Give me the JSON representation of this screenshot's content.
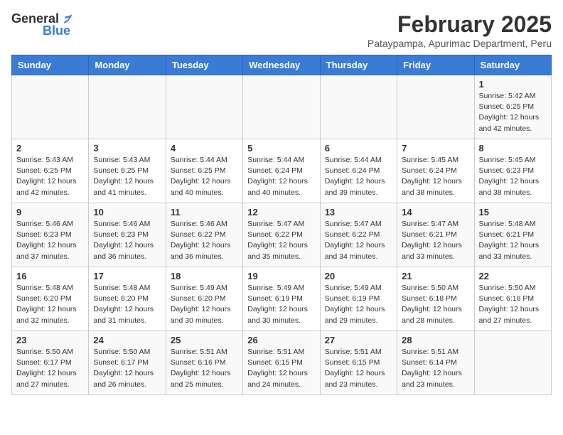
{
  "logo": {
    "text_general": "General",
    "text_blue": "Blue"
  },
  "title": "February 2025",
  "subtitle": "Pataypampa, Apurimac Department, Peru",
  "days_of_week": [
    "Sunday",
    "Monday",
    "Tuesday",
    "Wednesday",
    "Thursday",
    "Friday",
    "Saturday"
  ],
  "weeks": [
    [
      {
        "day": "",
        "info": ""
      },
      {
        "day": "",
        "info": ""
      },
      {
        "day": "",
        "info": ""
      },
      {
        "day": "",
        "info": ""
      },
      {
        "day": "",
        "info": ""
      },
      {
        "day": "",
        "info": ""
      },
      {
        "day": "1",
        "info": "Sunrise: 5:42 AM\nSunset: 6:25 PM\nDaylight: 12 hours\nand 42 minutes."
      }
    ],
    [
      {
        "day": "2",
        "info": "Sunrise: 5:43 AM\nSunset: 6:25 PM\nDaylight: 12 hours\nand 42 minutes."
      },
      {
        "day": "3",
        "info": "Sunrise: 5:43 AM\nSunset: 6:25 PM\nDaylight: 12 hours\nand 41 minutes."
      },
      {
        "day": "4",
        "info": "Sunrise: 5:44 AM\nSunset: 6:25 PM\nDaylight: 12 hours\nand 40 minutes."
      },
      {
        "day": "5",
        "info": "Sunrise: 5:44 AM\nSunset: 6:24 PM\nDaylight: 12 hours\nand 40 minutes."
      },
      {
        "day": "6",
        "info": "Sunrise: 5:44 AM\nSunset: 6:24 PM\nDaylight: 12 hours\nand 39 minutes."
      },
      {
        "day": "7",
        "info": "Sunrise: 5:45 AM\nSunset: 6:24 PM\nDaylight: 12 hours\nand 38 minutes."
      },
      {
        "day": "8",
        "info": "Sunrise: 5:45 AM\nSunset: 6:23 PM\nDaylight: 12 hours\nand 38 minutes."
      }
    ],
    [
      {
        "day": "9",
        "info": "Sunrise: 5:46 AM\nSunset: 6:23 PM\nDaylight: 12 hours\nand 37 minutes."
      },
      {
        "day": "10",
        "info": "Sunrise: 5:46 AM\nSunset: 6:23 PM\nDaylight: 12 hours\nand 36 minutes."
      },
      {
        "day": "11",
        "info": "Sunrise: 5:46 AM\nSunset: 6:22 PM\nDaylight: 12 hours\nand 36 minutes."
      },
      {
        "day": "12",
        "info": "Sunrise: 5:47 AM\nSunset: 6:22 PM\nDaylight: 12 hours\nand 35 minutes."
      },
      {
        "day": "13",
        "info": "Sunrise: 5:47 AM\nSunset: 6:22 PM\nDaylight: 12 hours\nand 34 minutes."
      },
      {
        "day": "14",
        "info": "Sunrise: 5:47 AM\nSunset: 6:21 PM\nDaylight: 12 hours\nand 33 minutes."
      },
      {
        "day": "15",
        "info": "Sunrise: 5:48 AM\nSunset: 6:21 PM\nDaylight: 12 hours\nand 33 minutes."
      }
    ],
    [
      {
        "day": "16",
        "info": "Sunrise: 5:48 AM\nSunset: 6:20 PM\nDaylight: 12 hours\nand 32 minutes."
      },
      {
        "day": "17",
        "info": "Sunrise: 5:48 AM\nSunset: 6:20 PM\nDaylight: 12 hours\nand 31 minutes."
      },
      {
        "day": "18",
        "info": "Sunrise: 5:49 AM\nSunset: 6:20 PM\nDaylight: 12 hours\nand 30 minutes."
      },
      {
        "day": "19",
        "info": "Sunrise: 5:49 AM\nSunset: 6:19 PM\nDaylight: 12 hours\nand 30 minutes."
      },
      {
        "day": "20",
        "info": "Sunrise: 5:49 AM\nSunset: 6:19 PM\nDaylight: 12 hours\nand 29 minutes."
      },
      {
        "day": "21",
        "info": "Sunrise: 5:50 AM\nSunset: 6:18 PM\nDaylight: 12 hours\nand 28 minutes."
      },
      {
        "day": "22",
        "info": "Sunrise: 5:50 AM\nSunset: 6:18 PM\nDaylight: 12 hours\nand 27 minutes."
      }
    ],
    [
      {
        "day": "23",
        "info": "Sunrise: 5:50 AM\nSunset: 6:17 PM\nDaylight: 12 hours\nand 27 minutes."
      },
      {
        "day": "24",
        "info": "Sunrise: 5:50 AM\nSunset: 6:17 PM\nDaylight: 12 hours\nand 26 minutes."
      },
      {
        "day": "25",
        "info": "Sunrise: 5:51 AM\nSunset: 6:16 PM\nDaylight: 12 hours\nand 25 minutes."
      },
      {
        "day": "26",
        "info": "Sunrise: 5:51 AM\nSunset: 6:15 PM\nDaylight: 12 hours\nand 24 minutes."
      },
      {
        "day": "27",
        "info": "Sunrise: 5:51 AM\nSunset: 6:15 PM\nDaylight: 12 hours\nand 23 minutes."
      },
      {
        "day": "28",
        "info": "Sunrise: 5:51 AM\nSunset: 6:14 PM\nDaylight: 12 hours\nand 23 minutes."
      },
      {
        "day": "",
        "info": ""
      }
    ]
  ]
}
